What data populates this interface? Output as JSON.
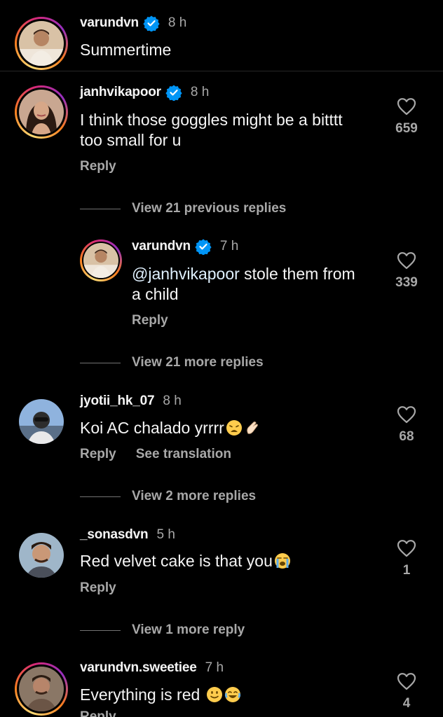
{
  "caption": {
    "username": "varundvn",
    "time": "8 h",
    "text": "Summertime",
    "verified": true
  },
  "comments": [
    {
      "username": "janhvikapoor",
      "verified": true,
      "time": "8 h",
      "line1": "I think those goggles might be a bitttt",
      "line2": "too small for u",
      "reply_label": "Reply",
      "likes": "659",
      "view_replies": "View 21 previous replies"
    },
    {
      "username": "varundvn",
      "verified": true,
      "time": "7 h",
      "mention": "@janhvikapoor",
      "line1": " stole them from",
      "line2": "a child",
      "reply_label": "Reply",
      "likes": "339",
      "view_replies": "View 21 more replies"
    },
    {
      "username": "jyotii_hk_07",
      "time": "8 h",
      "line1": "Koi AC chalado yrrrr",
      "emoji": [
        "weary-face",
        "pinching-hand"
      ],
      "reply_label": "Reply",
      "translate_label": "See translation",
      "likes": "68",
      "view_replies": "View 2 more replies"
    },
    {
      "username": "_sonasdvn",
      "time": "5 h",
      "line1": "Red velvet cake is that you",
      "emoji": [
        "loudly-crying-face"
      ],
      "reply_label": "Reply",
      "likes": "1",
      "view_replies": "View 1 more reply"
    },
    {
      "username": "varundvn.sweetiee",
      "time": "7 h",
      "line1": "Everything is red",
      "emoji": [
        "slightly-smiling-face",
        "joy-face"
      ],
      "reply_label": "Reply",
      "likes": "4"
    }
  ],
  "colors": {
    "background": "#000000",
    "primary_text": "#f5f5f5",
    "secondary_text": "#a8a8a8",
    "verified_blue": "#0095f6",
    "divider": "#262626"
  }
}
